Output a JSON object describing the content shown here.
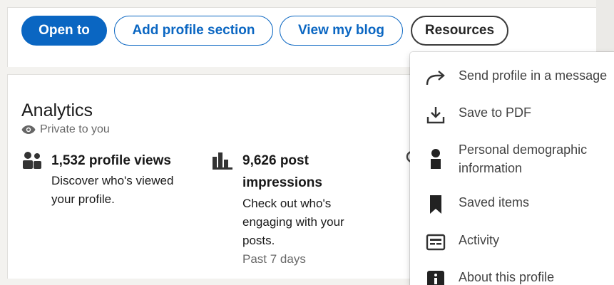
{
  "actions": {
    "open_to": "Open to",
    "add_profile_section": "Add profile section",
    "view_my_blog": "View my blog",
    "resources": "Resources"
  },
  "analytics": {
    "title": "Analytics",
    "privacy": "Private to you",
    "metrics": [
      {
        "title": "1,532 profile views",
        "desc_lines": [
          "Discover who's viewed",
          "your profile."
        ]
      },
      {
        "title_lines": [
          "9,626 post",
          "impressions"
        ],
        "desc_lines": [
          "Check out who's",
          "engaging with your",
          "posts."
        ],
        "sub": "Past 7 days"
      }
    ]
  },
  "resources_menu": {
    "items": [
      {
        "label": "Send profile in a message",
        "icon": "share-arrow-icon"
      },
      {
        "label": "Save to PDF",
        "icon": "download-icon"
      },
      {
        "label_lines": [
          "Personal demographic",
          "information"
        ],
        "icon": "person-icon"
      },
      {
        "label": "Saved items",
        "icon": "bookmark-icon"
      },
      {
        "label": "Activity",
        "icon": "activity-icon"
      },
      {
        "label": "About this profile",
        "icon": "info-icon"
      }
    ]
  },
  "colors": {
    "primary": "#0a66c2",
    "background": "#f3f2ef",
    "card": "#ffffff"
  }
}
